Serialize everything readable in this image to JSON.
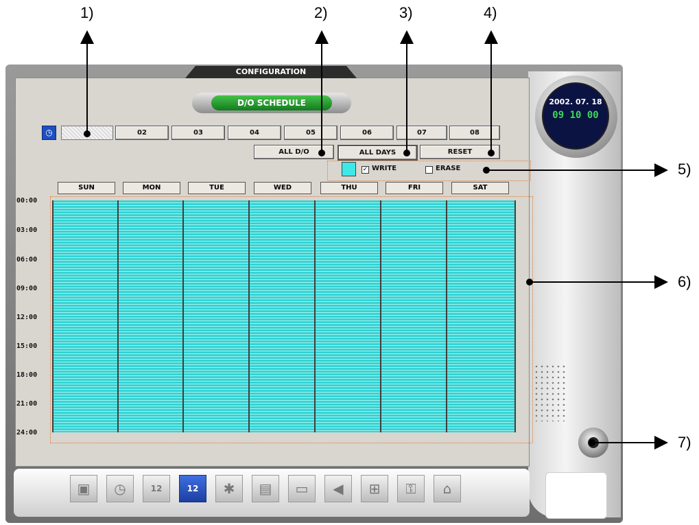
{
  "callouts": [
    "1)",
    "2)",
    "3)",
    "4)",
    "5)",
    "6)",
    "7)"
  ],
  "window": {
    "tab_title": "CONFIGURATION",
    "panel_title": "D/O SCHEDULE"
  },
  "clock": {
    "date": "2002. 07. 18",
    "time": "09 10 00"
  },
  "channels": {
    "icon": "clock-icon",
    "selected": "",
    "items": [
      "02",
      "03",
      "04",
      "05",
      "06",
      "07",
      "08"
    ]
  },
  "actions": {
    "all_do": "ALL D/O",
    "all_days": "ALL DAYS",
    "reset": "RESET"
  },
  "palette": {
    "write_label": "WRITE",
    "write_checked": true,
    "erase_label": "ERASE",
    "erase_checked": false,
    "write_color": "#3fe8e8"
  },
  "days": [
    "SUN",
    "MON",
    "TUE",
    "WED",
    "THU",
    "FRI",
    "SAT"
  ],
  "time_labels": [
    "00:00",
    "03:00",
    "06:00",
    "09:00",
    "12:00",
    "15:00",
    "18:00",
    "21:00",
    "24:00"
  ],
  "toolbar": [
    "camera-icon",
    "clock-icon",
    "calendar-icon",
    "schedule-icon",
    "motion-icon",
    "clapper-icon",
    "monitor-icon",
    "speaker-icon",
    "network-icon",
    "key-icon",
    "user-icon"
  ],
  "toolbar_active": "schedule-icon"
}
